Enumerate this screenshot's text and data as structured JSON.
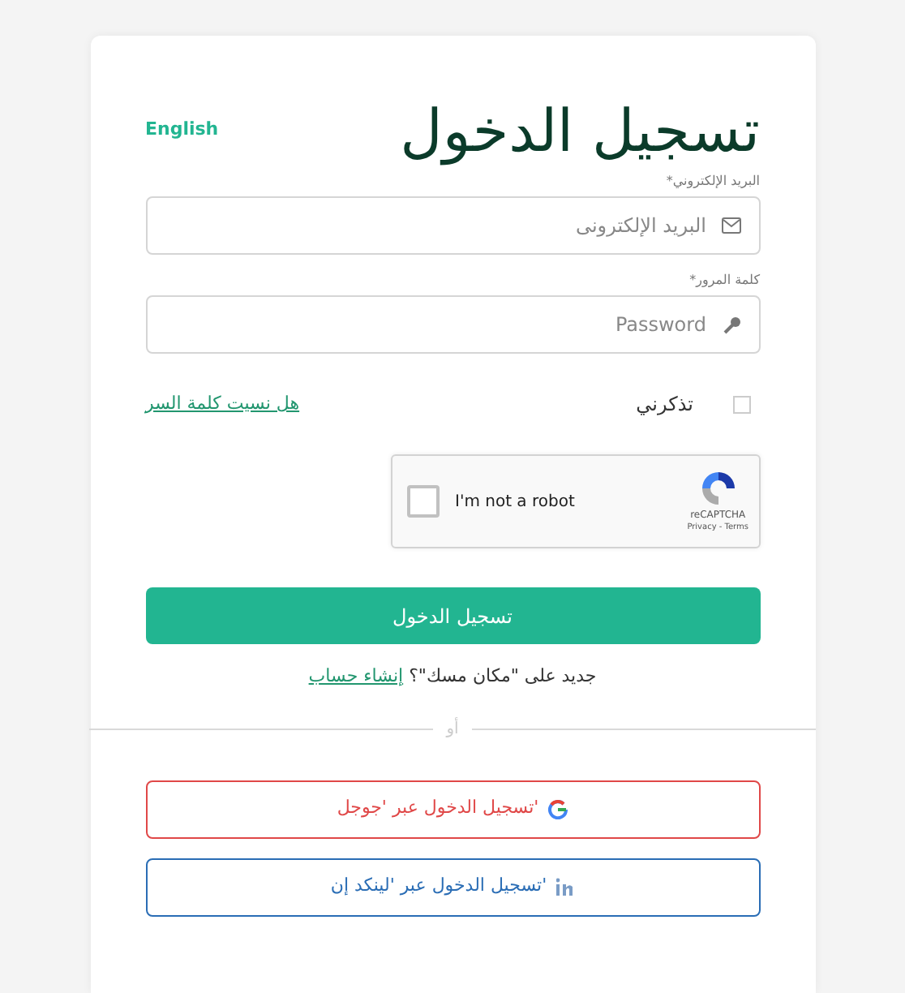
{
  "language_link": "English",
  "title": "تسجيل الدخول",
  "fields": [
    {
      "label": "البريد الإلكتروني*",
      "placeholder": "البريد الإلكترونى",
      "kind": "email"
    },
    {
      "label": "كلمة المرور*",
      "placeholder": "Password",
      "kind": "password"
    }
  ],
  "remember": {
    "label": "تذكرني",
    "checked": false
  },
  "forgot_link": "هل نسيت كلمة السر",
  "captcha": {
    "label": "I'm not a robot",
    "checked": false,
    "brand": "reCAPTCHA",
    "links": "Privacy - Terms"
  },
  "submit": "تسجيل الدخول",
  "signup": {
    "text": "جديد على \"مكان مسك\"؟",
    "link": "إنشاء حساب"
  },
  "divider": "أو",
  "social": [
    {
      "kind": "google",
      "label": "'تسجيل الدخول عبر 'جوجل",
      "color": "#e04848"
    },
    {
      "kind": "linkedin",
      "label": "'تسجيل الدخول عبر 'لينكد إن",
      "color": "#2a6db5"
    }
  ]
}
